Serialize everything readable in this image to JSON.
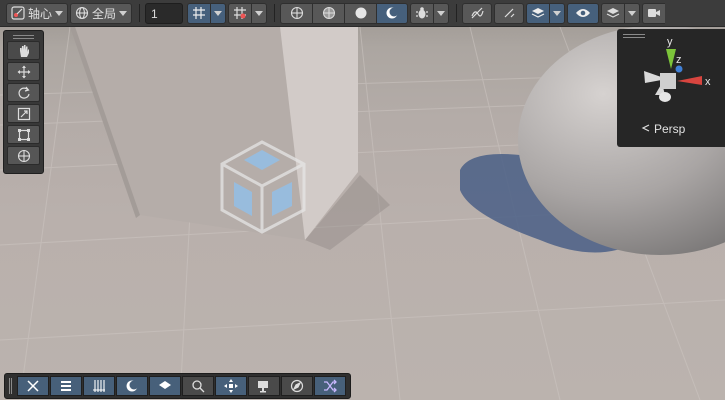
{
  "toolbar": {
    "pivot_label": "轴心",
    "global_label": "全局",
    "increment_value": "1"
  },
  "gizmo": {
    "y_axis_label": "y",
    "z_axis_label": "z",
    "x_axis_label": "x",
    "projection_label": "Persp"
  },
  "colors": {
    "toolbar_bg": "#3c3c3c",
    "button_bg": "#585858",
    "active_blue": "#46607c",
    "axis_x": "#d8453f",
    "axis_y": "#7cc43a",
    "axis_z": "#3f7fd6"
  },
  "icons": {
    "tools": [
      "hand-icon",
      "move-icon",
      "rotate-icon",
      "scale-icon",
      "rect-transform-icon",
      "transform-icon"
    ],
    "bottom_bar": [
      "tools-icon",
      "component-icon",
      "grid-snap-icon",
      "shading-icon",
      "layers-icon",
      "search-icon",
      "transform-handle-icon",
      "camera-icon",
      "navigate-icon",
      "shuffle-icon"
    ]
  }
}
